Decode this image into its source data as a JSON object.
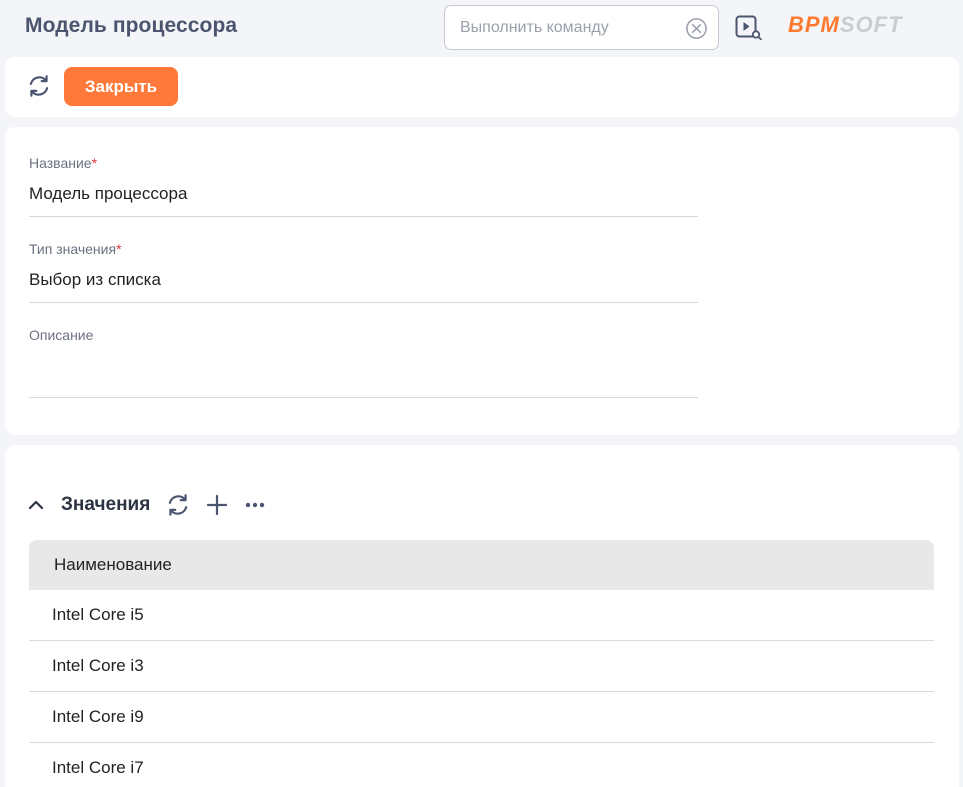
{
  "header": {
    "title": "Модель процессора",
    "command_placeholder": "Выполнить команду",
    "logo_bpm": "BPM",
    "logo_soft": "SOFT",
    "brand_color": "#ff7a2f"
  },
  "toolbar": {
    "close_label": "Закрыть"
  },
  "form": {
    "name_label": "Название",
    "name_value": "Модель процессора",
    "type_label": "Тип значения",
    "type_value": "Выбор из списка",
    "description_label": "Описание",
    "description_value": "",
    "required_mark": "*"
  },
  "detail": {
    "title": "Значения",
    "column_header": "Наименование",
    "rows": [
      "Intel Core i5",
      "Intel Core i3",
      "Intel Core i9",
      "Intel Core i7"
    ]
  },
  "icons": {
    "refresh": "refresh-icon",
    "clear": "clear-icon",
    "play_search": "play-search-icon",
    "chevron": "chevron-up-icon",
    "add": "plus-icon",
    "more": "more-icon"
  }
}
